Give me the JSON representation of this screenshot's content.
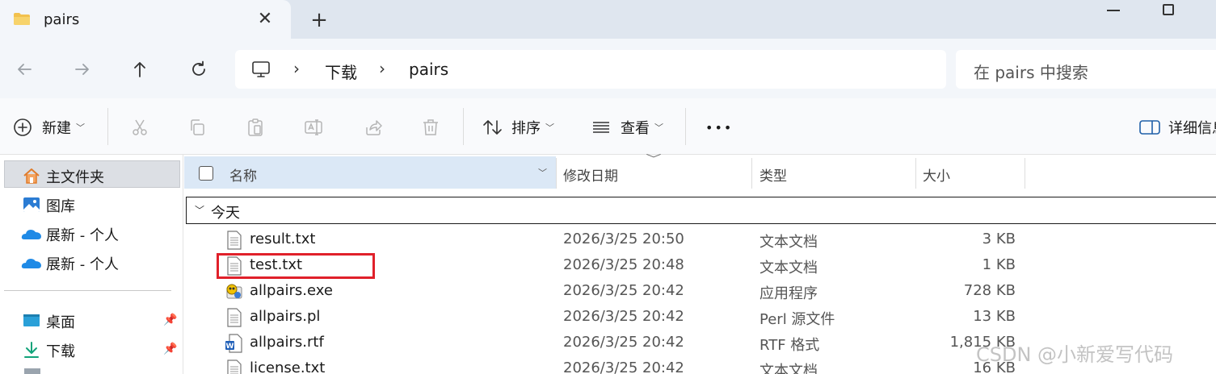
{
  "window": {
    "tab_title": "pairs",
    "tab_close_glyph": "✕",
    "new_tab_glyph": "+"
  },
  "address": {
    "separator": "›",
    "crumbs": [
      "下载",
      "pairs"
    ],
    "search_placeholder": "在 pairs 中搜索"
  },
  "toolbar": {
    "new_label": "新建",
    "sort_label": "排序",
    "view_label": "查看",
    "more_label": "•••",
    "details_label": "详细信息"
  },
  "sidebar": {
    "items": [
      {
        "label": "主文件夹",
        "icon": "home-icon"
      },
      {
        "label": "图库",
        "icon": "gallery-icon"
      },
      {
        "label": "展新 - 个人",
        "icon": "onedrive-icon"
      },
      {
        "label": "展新 - 个人",
        "icon": "onedrive-icon"
      }
    ],
    "pinned": [
      {
        "label": "桌面",
        "icon": "desktop-icon"
      },
      {
        "label": "下载",
        "icon": "download-icon"
      }
    ]
  },
  "list": {
    "columns": {
      "name": "名称",
      "date": "修改日期",
      "type": "类型",
      "size": "大小"
    },
    "group_label": "今天",
    "rows": [
      {
        "name": "result.txt",
        "date": "2026/3/25 20:50",
        "type": "文本文档",
        "size": "3 KB",
        "icon": "text-file-icon"
      },
      {
        "name": "test.txt",
        "date": "2026/3/25 20:48",
        "type": "文本文档",
        "size": "1 KB",
        "icon": "text-file-icon"
      },
      {
        "name": "allpairs.exe",
        "date": "2026/3/25 20:42",
        "type": "应用程序",
        "size": "728 KB",
        "icon": "exe-file-icon"
      },
      {
        "name": "allpairs.pl",
        "date": "2026/3/25 20:42",
        "type": "Perl 源文件",
        "size": "13 KB",
        "icon": "perl-file-icon"
      },
      {
        "name": "allpairs.rtf",
        "date": "2026/3/25 20:42",
        "type": "RTF 格式",
        "size": "1,815 KB",
        "icon": "word-file-icon"
      },
      {
        "name": "license.txt",
        "date": "2026/3/25 20:42",
        "type": "文本文档",
        "size": "16 KB",
        "icon": "text-file-icon"
      }
    ]
  },
  "colors": {
    "highlight": "#e0202a",
    "selected_header": "#dbe8f6",
    "title_bar": "#dfe6ef"
  },
  "watermark": "CSDN @小新爱写代码"
}
